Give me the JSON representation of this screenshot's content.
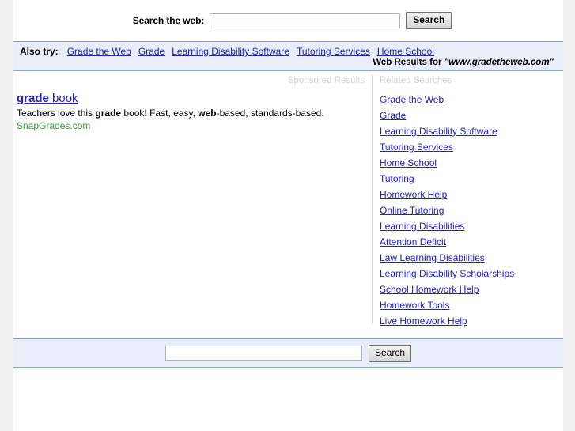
{
  "top_search": {
    "label": "Search the web:",
    "input_value": "",
    "placeholder": "",
    "button_label": "Search"
  },
  "also_try": {
    "label": "Also try:",
    "links": [
      "Grade the Web",
      "Grade",
      "Learning Disability Software",
      "Tutoring Services",
      "Home School"
    ],
    "web_results_prefix": "Web Results for",
    "query": "\"www.gradetheweb.com\""
  },
  "columns": {
    "sponsored_header": "Sponsored Results",
    "related_header": "Related Searches"
  },
  "sponsored_results": [
    {
      "title_bold": "grade",
      "title_rest": " book",
      "desc_part1": "Teachers love this ",
      "desc_bold1": "grade",
      "desc_part2": " book! Fast, easy, ",
      "desc_bold2": "web",
      "desc_part3": "-based, standards-based.",
      "url": "SnapGrades.com"
    }
  ],
  "related_searches": [
    "Grade the Web",
    "Grade",
    "Learning Disability Software",
    "Tutoring Services",
    "Home School",
    "Tutoring",
    "Homework Help",
    "Online Tutoring",
    "Learning Disabilities",
    "Attention Deficit",
    "Law Learning Disabilities",
    "Learning Disability Scholarships",
    "School Homework Help",
    "Homework Tools",
    "Live Homework Help"
  ],
  "bottom_search": {
    "input_value": "",
    "placeholder": "",
    "button_label": "Search"
  },
  "colors": {
    "link": "#2020cc",
    "band_bg": "#e8edf8",
    "band_border": "#8ba4c4",
    "ad_url": "#3a9e3a",
    "column_header": "#d2d2d2",
    "page_margin": "#f0f0f1"
  }
}
